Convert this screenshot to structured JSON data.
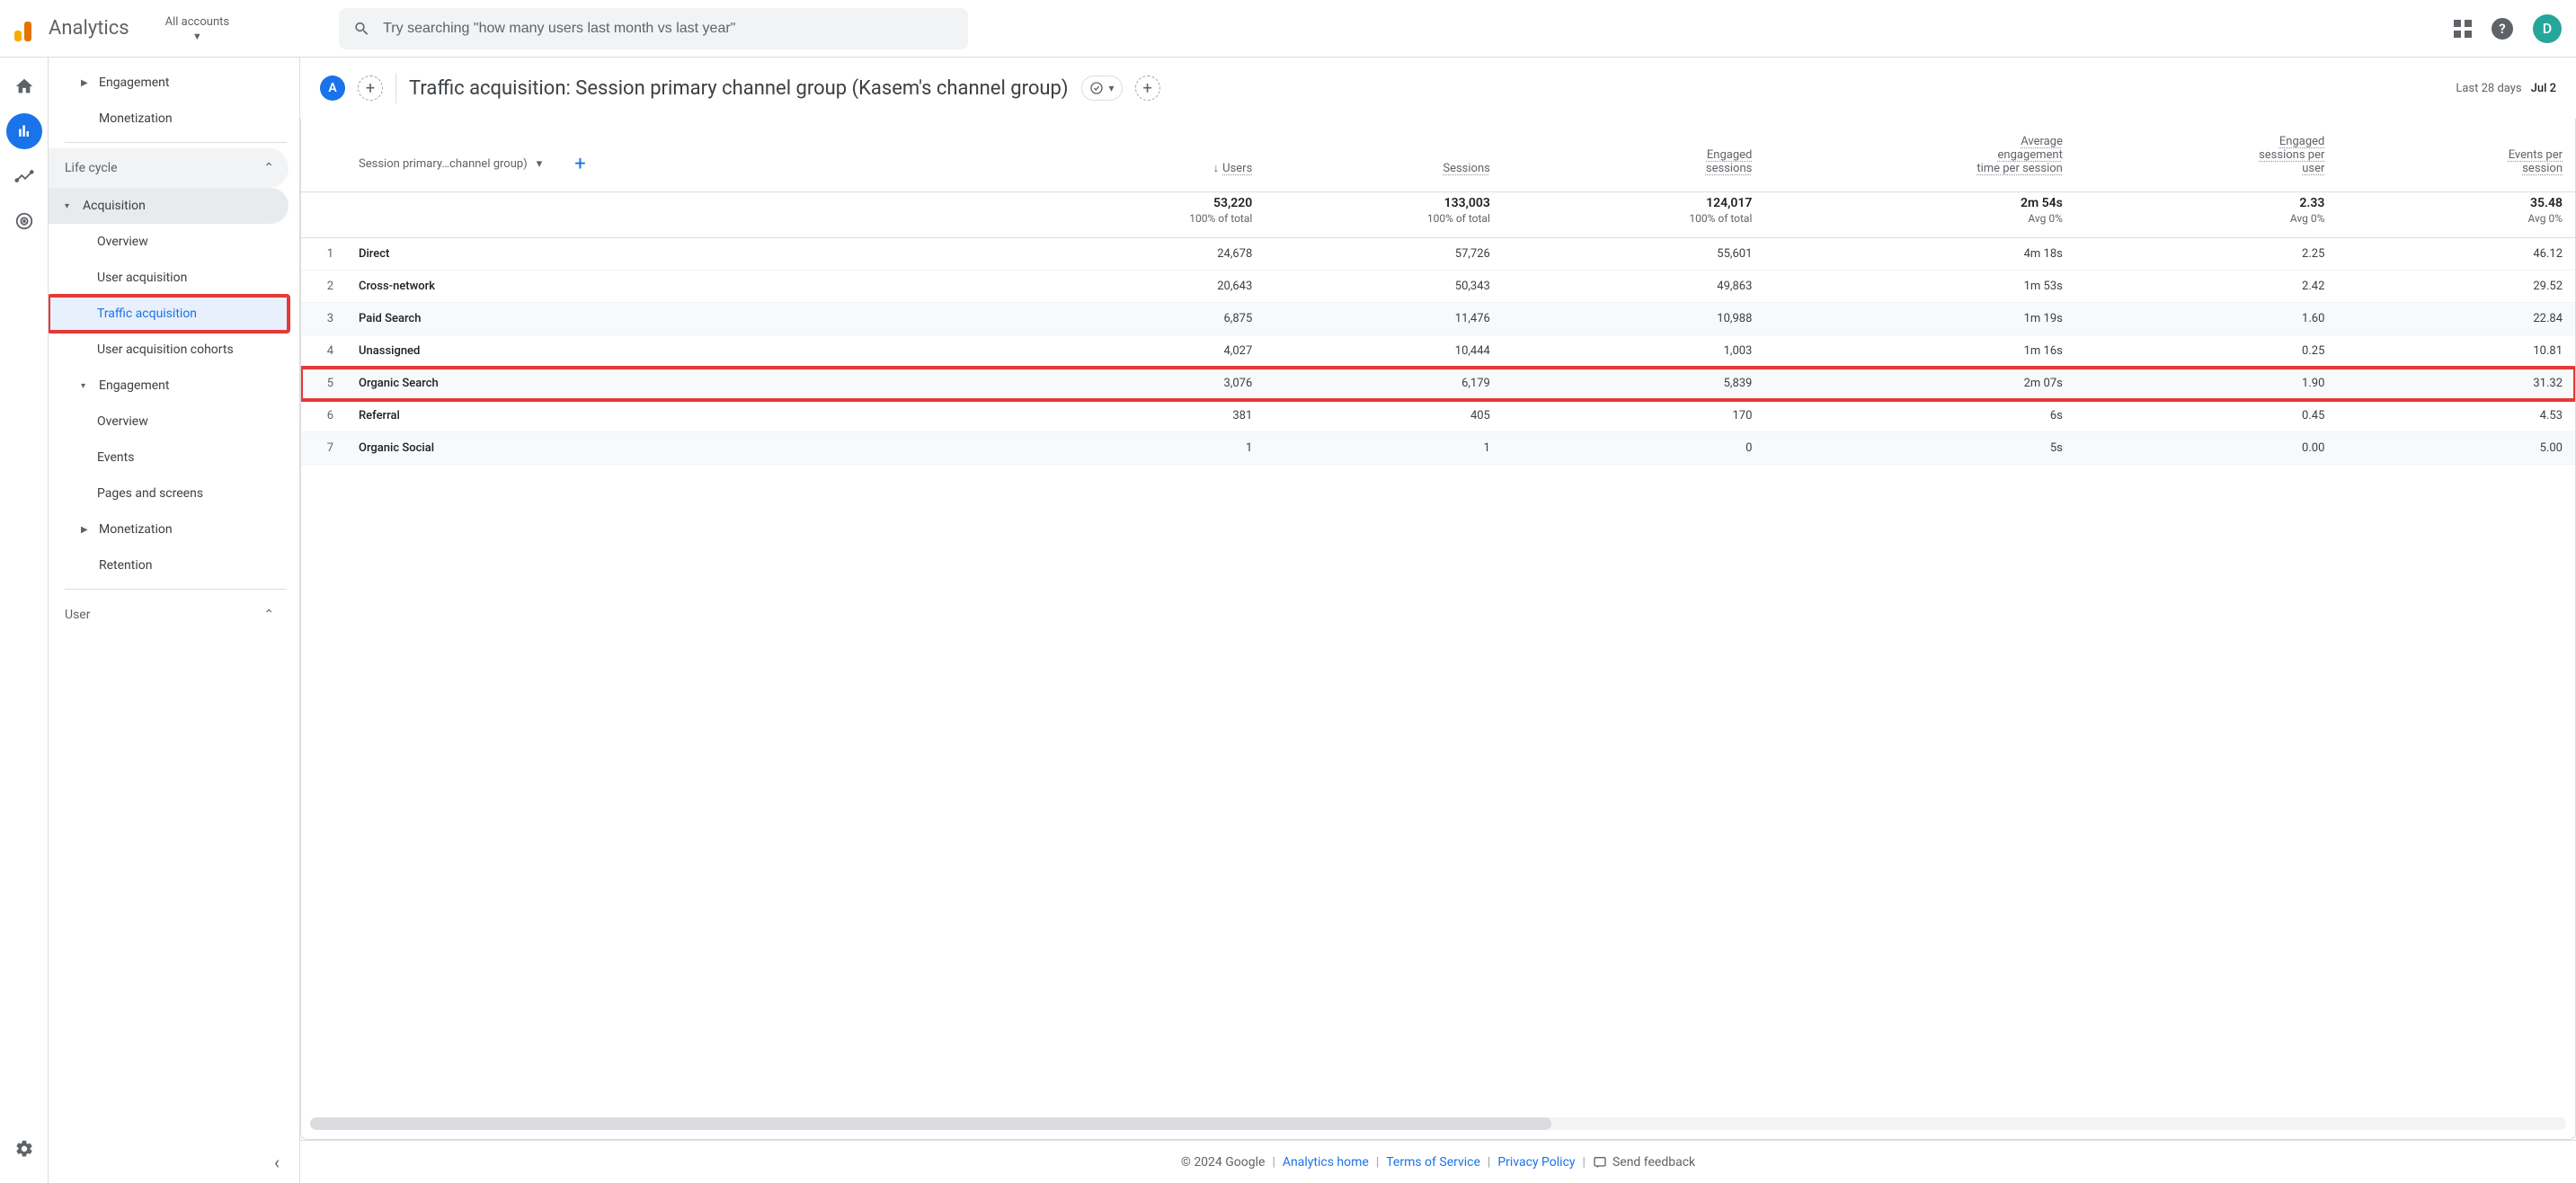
{
  "header": {
    "brand": "Analytics",
    "account_label": "All accounts",
    "search_placeholder": "Try searching \"how many users last month vs last year\"",
    "avatar_letter": "D"
  },
  "report": {
    "badge_letter": "A",
    "title": "Traffic acquisition: Session primary channel group (Kasem's channel group)",
    "date_label": "Last 28 days",
    "date_range": "Jul 2"
  },
  "sidebar": {
    "items_top": [
      {
        "label": "Engagement",
        "caret": true
      },
      {
        "label": "Monetization"
      }
    ],
    "group_lifecycle": "Life cycle",
    "acquisition": {
      "label": "Acquisition",
      "children": [
        "Overview",
        "User acquisition",
        "Traffic acquisition",
        "User acquisition cohorts"
      ],
      "selected_index": 2
    },
    "engagement": {
      "label": "Engagement",
      "children": [
        "Overview",
        "Events",
        "Pages and screens"
      ]
    },
    "monetization": {
      "label": "Monetization"
    },
    "retention": {
      "label": "Retention"
    },
    "group_user": "User"
  },
  "table": {
    "dimension_label": "Session primary…channel group)",
    "columns": [
      {
        "label": "Users",
        "sort": true
      },
      {
        "label": "Sessions"
      },
      {
        "label": "Engaged sessions"
      },
      {
        "label": "Average engagement time per session"
      },
      {
        "label": "Engaged sessions per user"
      },
      {
        "label": "Events per session"
      }
    ],
    "totals": {
      "values": [
        "53,220",
        "133,003",
        "124,017",
        "2m 54s",
        "2.33",
        "35.48"
      ],
      "subs": [
        "100% of total",
        "100% of total",
        "100% of total",
        "Avg 0%",
        "Avg 0%",
        "Avg 0%"
      ]
    },
    "rows": [
      {
        "idx": "1",
        "dim": "Direct",
        "vals": [
          "24,678",
          "57,726",
          "55,601",
          "4m 18s",
          "2.25",
          "46.12"
        ]
      },
      {
        "idx": "2",
        "dim": "Cross-network",
        "vals": [
          "20,643",
          "50,343",
          "49,863",
          "1m 53s",
          "2.42",
          "29.52"
        ]
      },
      {
        "idx": "3",
        "dim": "Paid Search",
        "vals": [
          "6,875",
          "11,476",
          "10,988",
          "1m 19s",
          "1.60",
          "22.84"
        ]
      },
      {
        "idx": "4",
        "dim": "Unassigned",
        "vals": [
          "4,027",
          "10,444",
          "1,003",
          "1m 16s",
          "0.25",
          "10.81"
        ]
      },
      {
        "idx": "5",
        "dim": "Organic Search",
        "vals": [
          "3,076",
          "6,179",
          "5,839",
          "2m 07s",
          "1.90",
          "31.32"
        ],
        "highlight": true
      },
      {
        "idx": "6",
        "dim": "Referral",
        "vals": [
          "381",
          "405",
          "170",
          "6s",
          "0.45",
          "4.53"
        ]
      },
      {
        "idx": "7",
        "dim": "Organic Social",
        "vals": [
          "1",
          "1",
          "0",
          "5s",
          "0.00",
          "5.00"
        ]
      }
    ]
  },
  "footer": {
    "copyright": "© 2024 Google",
    "links": [
      "Analytics home",
      "Terms of Service",
      "Privacy Policy"
    ],
    "feedback": "Send feedback"
  }
}
